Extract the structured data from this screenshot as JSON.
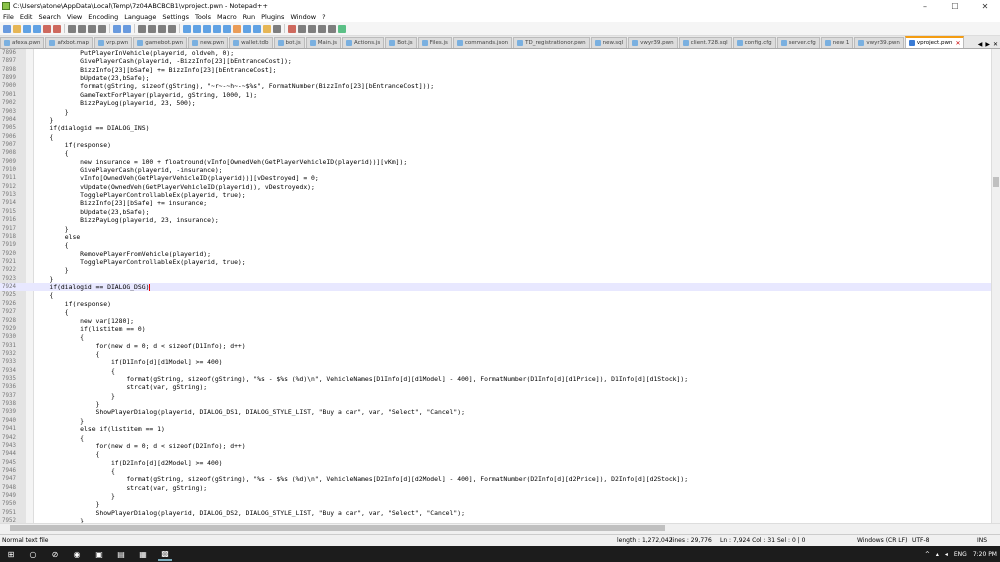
{
  "window": {
    "title": "C:\\Users\\atone\\AppData\\Local\\Temp\\7z04ABCBCB1\\vproject.pwn - Notepad++",
    "minimize": "–",
    "maximize": "☐",
    "close": "✕"
  },
  "menu": [
    "File",
    "Edit",
    "Search",
    "View",
    "Encoding",
    "Language",
    "Settings",
    "Tools",
    "Macro",
    "Run",
    "Plugins",
    "Window",
    "?"
  ],
  "toolbar_icons": [
    "new-file-icon",
    "open-icon",
    "save-icon",
    "save-all-icon",
    "close-icon",
    "close-all-icon",
    "print-icon",
    "cut-icon",
    "copy-icon",
    "paste-icon",
    "undo-icon",
    "redo-icon",
    "find-icon",
    "replace-icon",
    "zoom-in-icon",
    "zoom-out-icon",
    "sync-v-icon",
    "sync-h-icon",
    "word-wrap-icon",
    "all-chars-icon",
    "indent-guide-icon",
    "udl-icon",
    "doc-map-icon",
    "function-list-icon",
    "folder-workspace-icon",
    "monitor-icon",
    "record-macro-icon",
    "stop-macro-icon",
    "play-macro-icon",
    "play-multiple-icon",
    "save-macro-icon",
    "spell-check-icon"
  ],
  "tabs": [
    {
      "label": "afexa.pwn"
    },
    {
      "label": "afxbot.map"
    },
    {
      "label": "vrp.pwn"
    },
    {
      "label": "gamebot.pwn"
    },
    {
      "label": "new.pwn"
    },
    {
      "label": "wallet.tdb"
    },
    {
      "label": "bot.js"
    },
    {
      "label": "Main.js"
    },
    {
      "label": "Actions.js"
    },
    {
      "label": "Bot.js"
    },
    {
      "label": "Files.js"
    },
    {
      "label": "commands.json"
    },
    {
      "label": "TD_registrationor.pwn"
    },
    {
      "label": "new.sql"
    },
    {
      "label": "vwyr39.pwn"
    },
    {
      "label": "client.728.sql"
    },
    {
      "label": "config.cfg"
    },
    {
      "label": "server.cfg"
    },
    {
      "label": "new 1"
    },
    {
      "label": "vwyr39.pwn"
    },
    {
      "label": "vproject.pwn",
      "active": true,
      "close": "✕"
    }
  ],
  "tab_arrows": [
    "◀",
    "▶",
    "✕"
  ],
  "current_line": "7924",
  "code": [
    {
      "n": "7896",
      "t": "            PutPlayerInVehicle(playerid, oldveh, 0);"
    },
    {
      "n": "7897",
      "t": "            GivePlayerCash(playerid, -BizzInfo[23][bEntranceCost]);"
    },
    {
      "n": "7898",
      "t": "            BizzInfo[23][bSafe] += BizzInfo[23][bEntranceCost];"
    },
    {
      "n": "7899",
      "t": "            bUpdate(23,bSafe);"
    },
    {
      "n": "7900",
      "t": "            format(gString, sizeof(gString), \"~r~-~h~-~$%s\", FormatNumber(BizzInfo[23][bEntranceCost]));"
    },
    {
      "n": "7901",
      "t": "            GameTextForPlayer(playerid, gString, 1000, 1);"
    },
    {
      "n": "7902",
      "t": "            BizzPayLog(playerid, 23, 500);"
    },
    {
      "n": "7903",
      "t": "        }"
    },
    {
      "n": "7904",
      "t": "    }"
    },
    {
      "n": "7905",
      "t": "    if(dialogid == DIALOG_INS)"
    },
    {
      "n": "7906",
      "t": "    {"
    },
    {
      "n": "7907",
      "t": "        if(response)"
    },
    {
      "n": "7908",
      "t": "        {"
    },
    {
      "n": "7909",
      "t": "            new insurance = 100 + floatround(vInfo[OwnedVeh(GetPlayerVehicleID(playerid))][vKm]);"
    },
    {
      "n": "7910",
      "t": "            GivePlayerCash(playerid, -insurance);"
    },
    {
      "n": "7911",
      "t": "            vInfo[OwnedVeh(GetPlayerVehicleID(playerid))][vDestroyed] = 0;"
    },
    {
      "n": "7912",
      "t": "            vUpdate(OwnedVeh(GetPlayerVehicleID(playerid)), vDestroyedx);"
    },
    {
      "n": "7913",
      "t": "            TogglePlayerControllableEx(playerid, true);"
    },
    {
      "n": "7914",
      "t": "            BizzInfo[23][bSafe] += insurance;"
    },
    {
      "n": "7915",
      "t": "            bUpdate(23,bSafe);"
    },
    {
      "n": "7916",
      "t": "            BizzPayLog(playerid, 23, insurance);"
    },
    {
      "n": "7917",
      "t": "        }"
    },
    {
      "n": "7918",
      "t": "        else"
    },
    {
      "n": "7919",
      "t": "        {"
    },
    {
      "n": "7920",
      "t": "            RemovePlayerFromVehicle(playerid);"
    },
    {
      "n": "7921",
      "t": "            TogglePlayerControllableEx(playerid, true);"
    },
    {
      "n": "7922",
      "t": "        }"
    },
    {
      "n": "7923",
      "t": "    }"
    },
    {
      "n": "7924",
      "t": "    if(dialogid == DIALOG_DSG)"
    },
    {
      "n": "7925",
      "t": "    {"
    },
    {
      "n": "7926",
      "t": "        if(response)"
    },
    {
      "n": "7927",
      "t": "        {"
    },
    {
      "n": "7928",
      "t": "            new var[1280];"
    },
    {
      "n": "7929",
      "t": "            if(listitem == 0)"
    },
    {
      "n": "7930",
      "t": "            {"
    },
    {
      "n": "7931",
      "t": "                for(new d = 0; d < sizeof(D1Info); d++)"
    },
    {
      "n": "7932",
      "t": "                {"
    },
    {
      "n": "7933",
      "t": "                    if(D1Info[d][d1Model] >= 400)"
    },
    {
      "n": "7934",
      "t": "                    {"
    },
    {
      "n": "7935",
      "t": "                        format(gString, sizeof(gString), \"%s - $%s (%d)\\n\", VehicleNames[D1Info[d][d1Model] - 400], FormatNumber(D1Info[d][d1Price]), D1Info[d][d1Stock]);"
    },
    {
      "n": "7936",
      "t": "                        strcat(var, gString);"
    },
    {
      "n": "7937",
      "t": "                    }"
    },
    {
      "n": "7938",
      "t": "                }"
    },
    {
      "n": "7939",
      "t": "                ShowPlayerDialog(playerid, DIALOG_DS1, DIALOG_STYLE_LIST, \"Buy a car\", var, \"Select\", \"Cancel\");"
    },
    {
      "n": "7940",
      "t": "            }"
    },
    {
      "n": "7941",
      "t": "            else if(listitem == 1)"
    },
    {
      "n": "7942",
      "t": "            {"
    },
    {
      "n": "7943",
      "t": "                for(new d = 0; d < sizeof(D2Info); d++)"
    },
    {
      "n": "7944",
      "t": "                {"
    },
    {
      "n": "7945",
      "t": "                    if(D2Info[d][d2Model] >= 400)"
    },
    {
      "n": "7946",
      "t": "                    {"
    },
    {
      "n": "7947",
      "t": "                        format(gString, sizeof(gString), \"%s - $%s (%d)\\n\", VehicleNames[D2Info[d][d2Model] - 400], FormatNumber(D2Info[d][d2Price]), D2Info[d][d2Stock]);"
    },
    {
      "n": "7948",
      "t": "                        strcat(var, gString);"
    },
    {
      "n": "7949",
      "t": "                    }"
    },
    {
      "n": "7950",
      "t": "                }"
    },
    {
      "n": "7951",
      "t": "                ShowPlayerDialog(playerid, DIALOG_DS2, DIALOG_STYLE_LIST, \"Buy a car\", var, \"Select\", \"Cancel\");"
    },
    {
      "n": "7952",
      "t": "            }"
    }
  ],
  "status": {
    "file_type": "Normal text file",
    "length": "length : 1,272,042",
    "lines": "lines : 29,776",
    "position": "Ln : 7,924    Col : 31    Sel : 0 | 0",
    "eol": "Windows (CR LF)",
    "encoding": "UTF-8",
    "mode": "INS"
  },
  "taskbar": {
    "start": "⊞",
    "search": "○",
    "apps": [
      "⊘",
      "◉",
      "▣",
      "▤",
      "▦",
      "▩"
    ],
    "tray": {
      "up": "^",
      "lang": "ENG",
      "time": "7:20 PM"
    }
  }
}
